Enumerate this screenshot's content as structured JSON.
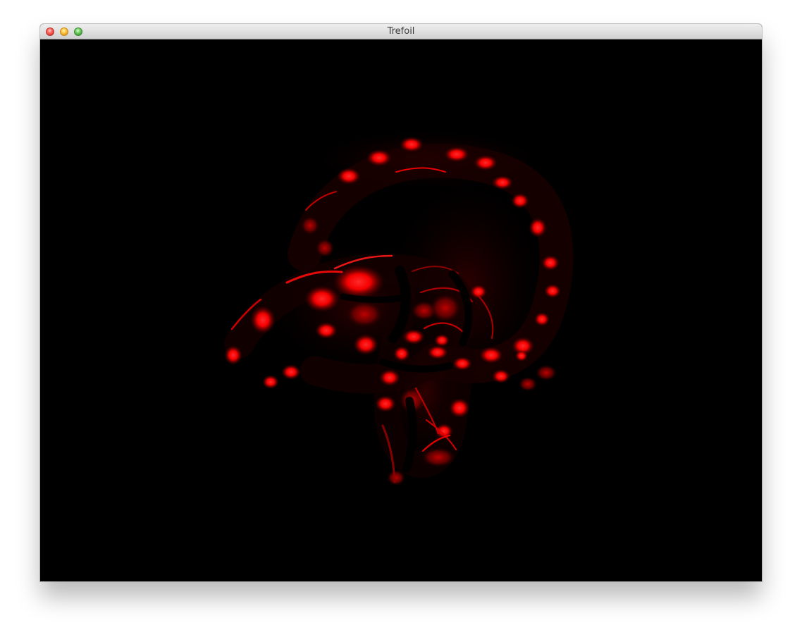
{
  "window": {
    "title": "Trefoil"
  },
  "controls": {
    "close": "close-window",
    "minimize": "minimize-window",
    "zoom": "zoom-window"
  },
  "colors": {
    "background": "#000000",
    "accent": "#ff0000",
    "shadow_red": "#5a0000"
  },
  "scene": {
    "description_visible": "",
    "icons": [
      "close-icon",
      "minimize-icon",
      "zoom-icon"
    ]
  }
}
